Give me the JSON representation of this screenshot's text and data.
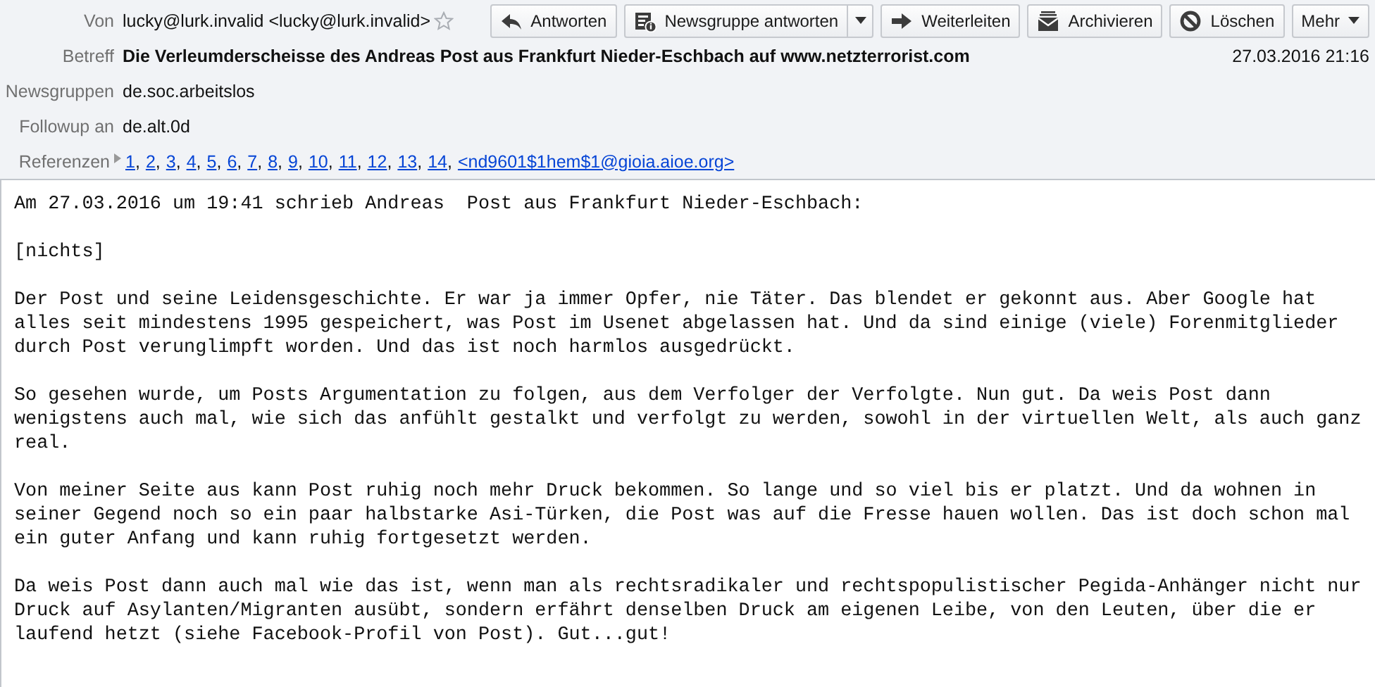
{
  "header": {
    "from": {
      "label": "Von",
      "value": "lucky@lurk.invalid <lucky@lurk.invalid>",
      "starred": false
    },
    "subject": {
      "label": "Betreff",
      "value": "Die Verleumderscheisse des Andreas Post aus Frankfurt Nieder-Eschbach auf www.netzterrorist.com",
      "date": "27.03.2016 21:16"
    },
    "fields": [
      {
        "label": "Newsgruppen",
        "value": "de.soc.arbeitslos"
      },
      {
        "label": "Followup an",
        "value": "de.alt.0d"
      }
    ],
    "references": {
      "label": "Referenzen",
      "expanded": false,
      "links": [
        {
          "text": "1",
          "sep": ","
        },
        {
          "text": "2",
          "sep": ","
        },
        {
          "text": "3",
          "sep": ","
        },
        {
          "text": "4",
          "sep": ","
        },
        {
          "text": "5",
          "sep": ","
        },
        {
          "text": "6",
          "sep": ","
        },
        {
          "text": "7",
          "sep": ","
        },
        {
          "text": "8",
          "sep": ","
        },
        {
          "text": "9",
          "sep": ","
        },
        {
          "text": "10",
          "sep": ","
        },
        {
          "text": "11",
          "sep": ","
        },
        {
          "text": "12",
          "sep": ","
        },
        {
          "text": "13",
          "sep": ","
        },
        {
          "text": "14",
          "sep": ","
        },
        {
          "text": "<nd9601$1hem$1@gioia.aioe.org>"
        }
      ]
    }
  },
  "toolbar": [
    {
      "kind": "reply",
      "label": "Antworten"
    },
    {
      "kind": "reply-group",
      "label": "Newsgruppe antworten",
      "split": true
    },
    {
      "kind": "forward",
      "label": "Weiterleiten"
    },
    {
      "kind": "archive",
      "label": "Archivieren"
    },
    {
      "kind": "delete",
      "label": "Löschen"
    },
    {
      "kind": "more",
      "label": "Mehr"
    }
  ],
  "body": {
    "paragraphs": [
      "Am 27.03.2016 um 19:41 schrieb Andreas  Post aus Frankfurt Nieder-Eschbach:",
      "[nichts]",
      "Der Post und seine Leidensgeschichte. Er war ja immer Opfer, nie Täter. Das blendet er gekonnt aus. Aber Google hat\nalles seit mindestens 1995 gespeichert, was Post im Usenet abgelassen hat. Und da sind einige (viele) Forenmitglieder\ndurch Post verunglimpft worden. Und das ist noch harmlos ausgedrückt.",
      "So gesehen wurde, um Posts Argumentation zu folgen, aus dem Verfolger der Verfolgte. Nun gut. Da weis Post dann\nwenigstens auch mal, wie sich das anfühlt gestalkt und verfolgt zu werden, sowohl in der virtuellen Welt, als auch ganz\nreal.",
      "Von meiner Seite aus kann Post ruhig noch mehr Druck bekommen. So lange und so viel bis er platzt. Und da wohnen in\nseiner Gegend noch so ein paar halbstarke Asi-Türken, die Post was auf die Fresse hauen wollen. Das ist doch schon mal\nein guter Anfang und kann ruhig fortgesetzt werden.",
      "Da weis Post dann auch mal wie das ist, wenn man als rechtsradikaler und rechtspopulistischer Pegida-Anhänger nicht nur\nDruck auf Asylanten/Migranten ausübt, sondern erfährt denselben Druck am eigenen Leibe, von den Leuten, über die er\nlaufend hetzt (siehe Facebook-Profil von Post). Gut...gut!"
    ]
  }
}
